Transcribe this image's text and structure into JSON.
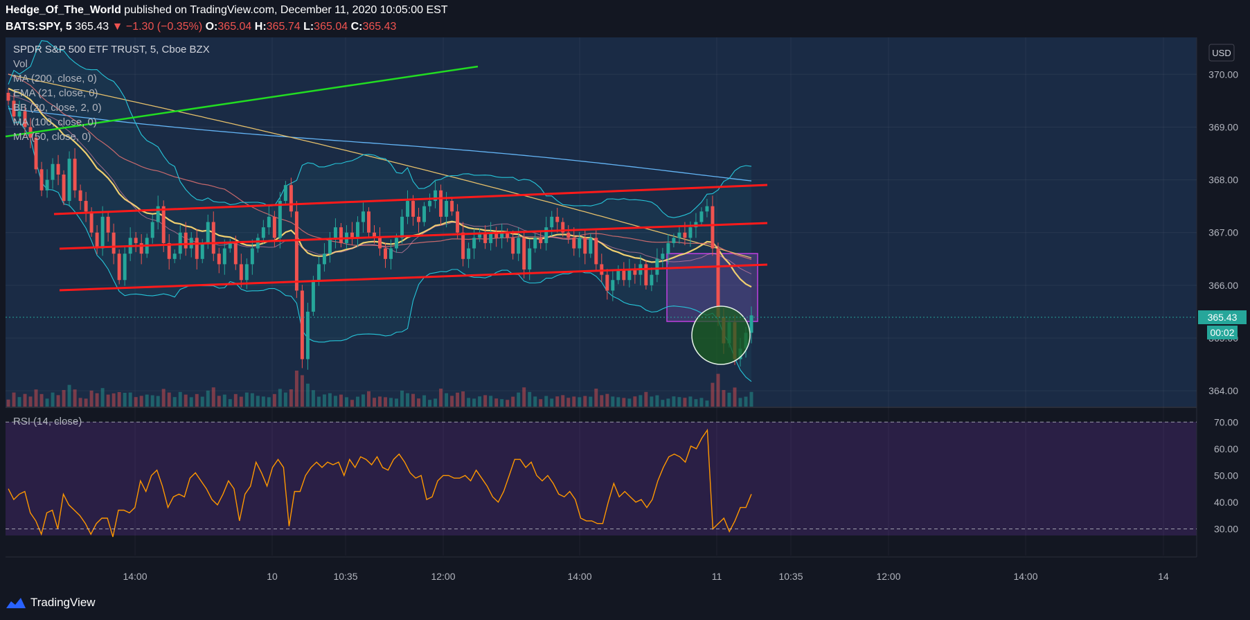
{
  "header": {
    "author": "Hedge_Of_The_World",
    "published_text": "published on TradingView.com, December 11, 2020 10:05:00 EST"
  },
  "quote": {
    "symbol": "BATS:SPY, 5",
    "last": "365.43",
    "change": "▼ −1.30 (−0.35%)",
    "o_label": "O:",
    "o": "365.04",
    "h_label": "H:",
    "h": "365.74",
    "l_label": "L:",
    "l": "365.04",
    "c_label": "C:",
    "c": "365.43"
  },
  "legend": [
    "SPDR S&P 500 ETF TRUST, 5, Cboe BZX",
    "Vol",
    "MA (200, close, 0)",
    "EMA (21, close, 0)",
    "BB (20, close, 2, 0)",
    "MA (100, close, 0)",
    "MA (50, close, 0)"
  ],
  "currency_button": "USD",
  "last_price_tag": "365.43",
  "countdown_tag": "00:02",
  "rsi_label": "RSI (14, close)",
  "footer": {
    "brand": "TradingView"
  },
  "colors": {
    "background": "#131722",
    "up": "#26a69a",
    "down": "#ef5350",
    "trendline_red": "#ff1a1a",
    "trendline_green": "#22dd22",
    "ma200": "#64b5f6",
    "ma100": "#e6c06b",
    "ema21": "#f0d070",
    "ma50": "#e57373",
    "bb": "#26c6da",
    "rsi": "#ff9800",
    "rsi_band": "#2a1f45",
    "box": "#9c27b0",
    "circle": "#1b5e20"
  },
  "chart_data": [
    {
      "type": "candlestick",
      "title": "SPDR S&P 500 ETF TRUST, 5, Cboe BZX",
      "y_axis_labels": [
        "370.00",
        "369.00",
        "368.00",
        "367.00",
        "366.00",
        "365.00",
        "364.00"
      ],
      "ylim": [
        363.7,
        370.7
      ],
      "x_axis_labels": [
        "14:00",
        "10",
        "10:35",
        "12:00",
        "14:00",
        "11",
        "10:35",
        "12:00",
        "14:00",
        "14"
      ],
      "last_price": 365.43,
      "close": [
        369.5,
        369.2,
        369.3,
        369.0,
        368.8,
        368.2,
        367.8,
        368.0,
        368.3,
        368.1,
        367.6,
        368.4,
        367.8,
        367.6,
        367.4,
        367.0,
        366.7,
        367.3,
        367.0,
        366.6,
        366.1,
        366.6,
        366.9,
        366.8,
        366.6,
        366.9,
        367.2,
        367.5,
        366.8,
        366.5,
        366.6,
        367.0,
        366.7,
        366.9,
        366.5,
        366.8,
        367.2,
        366.6,
        366.4,
        366.7,
        366.8,
        366.4,
        366.1,
        366.4,
        366.7,
        366.9,
        367.1,
        367.3,
        366.9,
        367.6,
        367.9,
        367.4,
        365.9,
        364.6,
        365.5,
        366.1,
        366.4,
        366.6,
        366.9,
        367.1,
        366.8,
        367.0,
        366.9,
        367.2,
        367.4,
        367.0,
        366.9,
        366.7,
        366.5,
        366.7,
        366.9,
        367.3,
        367.6,
        367.3,
        367.2,
        367.5,
        367.6,
        367.8,
        367.3,
        367.6,
        367.4,
        367.0,
        366.5,
        366.7,
        366.9,
        367.0,
        366.8,
        367.0,
        366.9,
        367.0,
        366.9,
        366.6,
        366.9,
        366.3,
        366.7,
        366.9,
        366.8,
        367.1,
        367.3,
        367.2,
        367.0,
        366.9,
        366.7,
        366.9,
        366.6,
        366.9,
        366.4,
        366.2,
        365.9,
        366.1,
        366.3,
        366.1,
        366.3,
        366.2,
        366.4,
        366.0,
        366.2,
        366.5,
        366.6,
        366.8,
        366.9,
        367.0,
        366.9,
        367.1,
        367.2,
        367.4,
        367.5,
        366.7,
        365.4,
        364.9,
        365.3,
        364.6,
        364.8,
        365.1,
        365.43
      ],
      "rsi": {
        "y_axis_labels": [
          "70.00",
          "60.00",
          "50.00",
          "40.00",
          "30.00"
        ],
        "ylim": [
          20,
          75
        ],
        "bands": [
          70,
          30
        ],
        "values": [
          45,
          41,
          43,
          44,
          36,
          33,
          28,
          36,
          37,
          30,
          43,
          39,
          37,
          35,
          32,
          28,
          32,
          34,
          34,
          27,
          37,
          37,
          36,
          38,
          48,
          44,
          50,
          52,
          46,
          38,
          42,
          43,
          42,
          49,
          51,
          48,
          45,
          41,
          39,
          43,
          48,
          45,
          33,
          43,
          46,
          55,
          51,
          46,
          53,
          56,
          53,
          31,
          44,
          44,
          50,
          53,
          55,
          53,
          55,
          54,
          55,
          50,
          56,
          53,
          57,
          56,
          54,
          57,
          53,
          52,
          56,
          58,
          55,
          51,
          49,
          50,
          41,
          42,
          48,
          50,
          50,
          49,
          49,
          50,
          48,
          52,
          49,
          46,
          42,
          40,
          44,
          50,
          56,
          56,
          53,
          55,
          50,
          48,
          50,
          47,
          43,
          42,
          44,
          41,
          34,
          33,
          33,
          32,
          32,
          40,
          47,
          42,
          44,
          42,
          40,
          41,
          38,
          41,
          48,
          53,
          57,
          58,
          57,
          55,
          61,
          60,
          64,
          67,
          30,
          32,
          34,
          29,
          33,
          38,
          38,
          43
        ]
      }
    }
  ]
}
